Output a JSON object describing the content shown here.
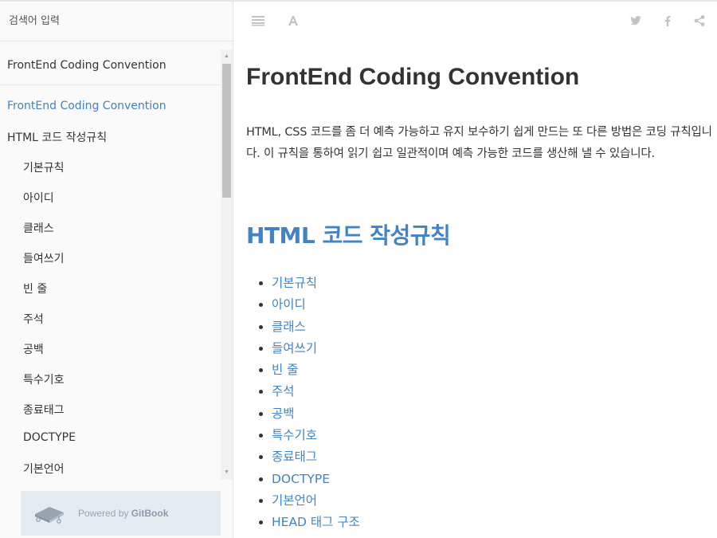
{
  "search": {
    "placeholder": "검색어 입력"
  },
  "sidebar": {
    "book_title": "FrontEnd Coding Convention",
    "items": [
      {
        "label": "FrontEnd Coding Convention",
        "active": true
      },
      {
        "label": "HTML 코드 작성규칙",
        "level": 1
      },
      {
        "label": "기본규칙",
        "level": 2
      },
      {
        "label": "아이디",
        "level": 2
      },
      {
        "label": "클래스",
        "level": 2
      },
      {
        "label": "들여쓰기",
        "level": 2
      },
      {
        "label": "빈 줄",
        "level": 2
      },
      {
        "label": "주석",
        "level": 2
      },
      {
        "label": "공백",
        "level": 2
      },
      {
        "label": "특수기호",
        "level": 2
      },
      {
        "label": "종료태그",
        "level": 2
      },
      {
        "label": "DOCTYPE",
        "level": 2
      },
      {
        "label": "기본언어",
        "level": 2
      }
    ],
    "powered_prefix": "Powered by",
    "powered_brand": "GitBook"
  },
  "toolbar": {
    "icons": [
      "toc-toggle-icon",
      "font-settings-icon",
      "twitter-icon",
      "facebook-icon",
      "share-icon"
    ]
  },
  "content": {
    "title": "FrontEnd Coding Convention",
    "intro": "HTML, CSS 코드를 좀 더 예측 가능하고 유지 보수하기 쉽게 만드는 또 다른 방법은 코딩 규칙입니다. 이 규칙을 통하여 읽기 쉽고 일관적이며 예측 가능한 코드를 생산해 낼 수 있습니다.",
    "section_title": "HTML 코드 작성규칙",
    "section_links": [
      "기본규칙",
      "아이디",
      "클래스",
      "들여쓰기",
      "빈 줄",
      "주석",
      "공백",
      "특수기호",
      "종료태그",
      "DOCTYPE",
      "기본언어",
      "HEAD 태그 구조"
    ]
  },
  "colors": {
    "link": "#4183c4",
    "text": "#333333",
    "sidebar_bg": "#fafafa",
    "toolbar_icon": "#c3c3c3"
  }
}
